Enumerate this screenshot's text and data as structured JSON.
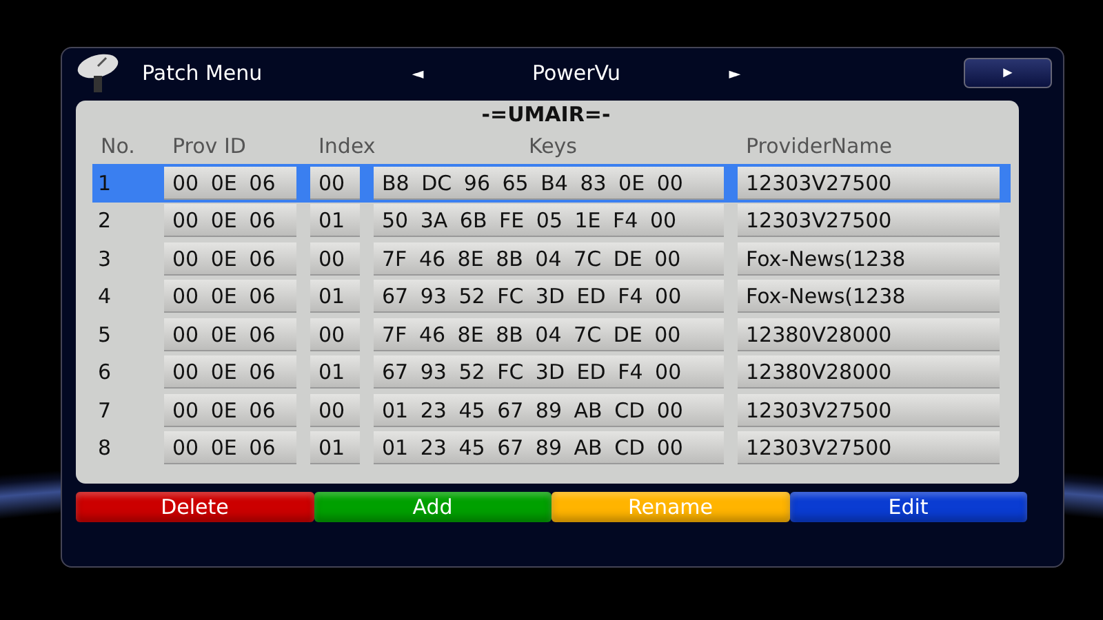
{
  "header": {
    "title": "Patch Menu",
    "selector": {
      "left_arrow": "◄",
      "value": "PowerVu",
      "right_arrow": "►"
    },
    "next_button": "►"
  },
  "panel_title": "-=UMAIR=-",
  "table": {
    "columns": [
      "No.",
      "Prov ID",
      "Index",
      "Keys",
      "ProviderName"
    ],
    "rows": [
      {
        "no": "1",
        "prov_id": "00 0E 06",
        "index": "00",
        "keys": "B8 DC 96 65 B4 83 0E 00",
        "provider": "12303V27500",
        "selected": true
      },
      {
        "no": "2",
        "prov_id": "00 0E 06",
        "index": "01",
        "keys": "50 3A 6B FE 05 1E F4 00",
        "provider": "12303V27500",
        "selected": false
      },
      {
        "no": "3",
        "prov_id": "00 0E 06",
        "index": "00",
        "keys": "7F 46 8E 8B 04 7C DE 00",
        "provider": "Fox-News(1238",
        "selected": false
      },
      {
        "no": "4",
        "prov_id": "00 0E 06",
        "index": "01",
        "keys": "67 93 52 FC 3D ED F4 00",
        "provider": "Fox-News(1238",
        "selected": false
      },
      {
        "no": "5",
        "prov_id": "00 0E 06",
        "index": "00",
        "keys": "7F 46 8E 8B 04 7C DE 00",
        "provider": "12380V28000",
        "selected": false
      },
      {
        "no": "6",
        "prov_id": "00 0E 06",
        "index": "01",
        "keys": "67 93 52 FC 3D ED F4 00",
        "provider": "12380V28000",
        "selected": false
      },
      {
        "no": "7",
        "prov_id": "00 0E 06",
        "index": "00",
        "keys": "01 23 45 67 89 AB CD 00",
        "provider": "12303V27500",
        "selected": false
      },
      {
        "no": "8",
        "prov_id": "00 0E 06",
        "index": "01",
        "keys": "01 23 45 67 89 AB CD 00",
        "provider": "12303V27500",
        "selected": false
      }
    ]
  },
  "buttons": [
    {
      "label": "Delete",
      "color": "#cc0000"
    },
    {
      "label": "Add",
      "color": "#00a000"
    },
    {
      "label": "Rename",
      "color": "#ffb400"
    },
    {
      "label": "Edit",
      "color": "#0a3cd2"
    }
  ]
}
